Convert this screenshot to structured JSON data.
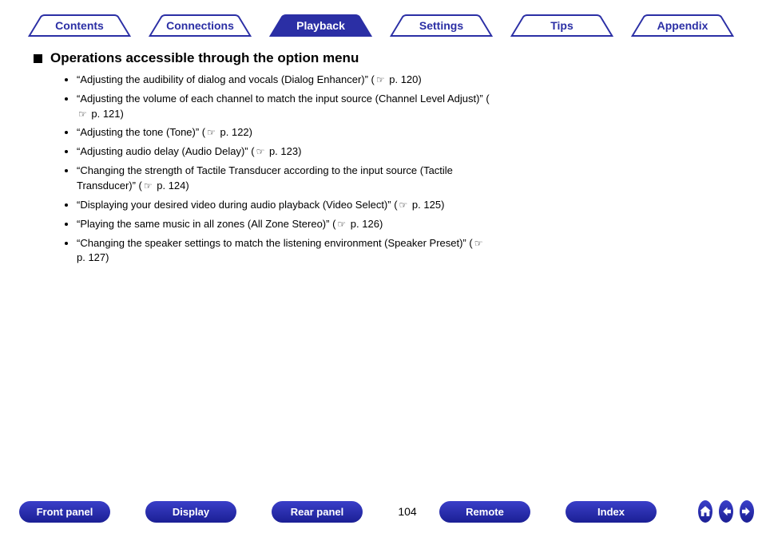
{
  "tabs": [
    {
      "label": "Contents",
      "active": false
    },
    {
      "label": "Connections",
      "active": false
    },
    {
      "label": "Playback",
      "active": true
    },
    {
      "label": "Settings",
      "active": false
    },
    {
      "label": "Tips",
      "active": false
    },
    {
      "label": "Appendix",
      "active": false
    }
  ],
  "heading": "Operations accessible through the option menu",
  "items": [
    {
      "text": "“Adjusting the audibility of dialog and vocals (Dialog Enhancer)” (",
      "page": "p. 120",
      "tail": ")"
    },
    {
      "text": "“Adjusting the volume of each channel to match the input source (Channel Level Adjust)” (",
      "page": "p. 121",
      "tail": ")"
    },
    {
      "text": "“Adjusting the tone (Tone)” (",
      "page": "p. 122",
      "tail": ")"
    },
    {
      "text": "“Adjusting audio delay (Audio Delay)” (",
      "page": "p. 123",
      "tail": ")"
    },
    {
      "text": "“Changing the strength of Tactile Transducer according to the input source (Tactile Transducer)” (",
      "page": "p. 124",
      "tail": ")"
    },
    {
      "text": "“Displaying your desired video during audio playback (Video Select)” (",
      "page": "p. 125",
      "tail": ")"
    },
    {
      "text": "“Playing the same music in all zones (All Zone Stereo)” (",
      "page": "p. 126",
      "tail": ")"
    },
    {
      "text": "“Changing the speaker settings to match the listening environment (Speaker Preset)” (",
      "page": "p. 127",
      "tail": ")"
    }
  ],
  "bottom_buttons": [
    "Front panel",
    "Display",
    "Rear panel"
  ],
  "page_number": "104",
  "bottom_buttons2": [
    "Remote",
    "Index"
  ]
}
